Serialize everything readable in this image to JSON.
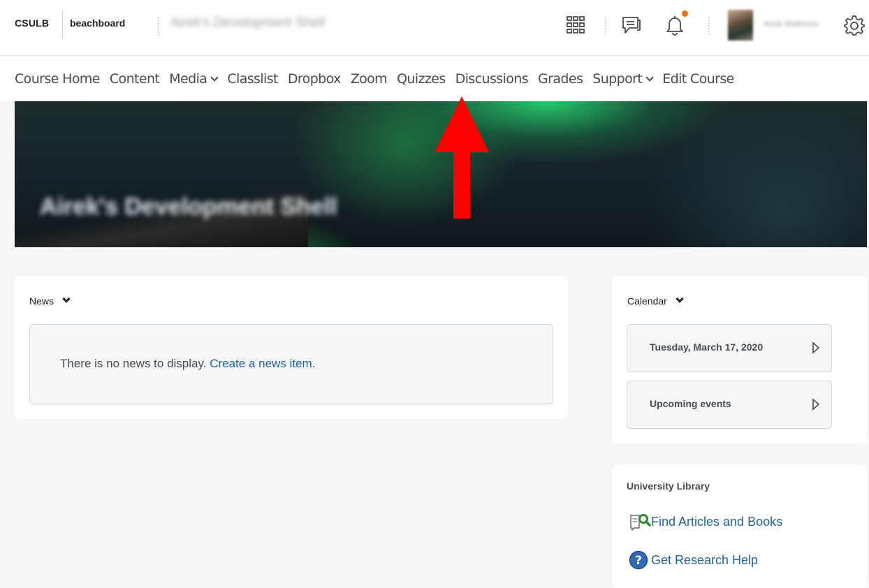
{
  "header": {
    "brand_left": "CSULB",
    "brand_right": "beachboard",
    "course_title": "Airek's Development Shell",
    "user_name": "Airek Mathews"
  },
  "nav": {
    "items": [
      {
        "label": "Course Home",
        "dropdown": false
      },
      {
        "label": "Content",
        "dropdown": false
      },
      {
        "label": "Media",
        "dropdown": true
      },
      {
        "label": "Classlist",
        "dropdown": false
      },
      {
        "label": "Dropbox",
        "dropdown": false
      },
      {
        "label": "Zoom",
        "dropdown": false
      },
      {
        "label": "Quizzes",
        "dropdown": false
      },
      {
        "label": "Discussions",
        "dropdown": false
      },
      {
        "label": "Grades",
        "dropdown": false
      },
      {
        "label": "Support",
        "dropdown": true
      },
      {
        "label": "Edit Course",
        "dropdown": false
      }
    ]
  },
  "banner": {
    "title": "Airek's Development Shell"
  },
  "news": {
    "heading": "News",
    "empty_text": "There is no news to display.",
    "create_link": "Create a news item."
  },
  "calendar": {
    "heading": "Calendar",
    "date": "Tuesday, March 17, 2020",
    "upcoming": "Upcoming events"
  },
  "library": {
    "heading": "University Library",
    "find_link": "Find Articles and Books",
    "help_link": "Get Research Help"
  },
  "colors": {
    "link": "#22649c",
    "annotation_arrow": "#ff0000",
    "notification_dot": "#e87511"
  },
  "icons": [
    "waffle-icon",
    "message-icon",
    "bell-icon",
    "gear-icon",
    "chevron-down-icon",
    "play-triangle-icon",
    "search-book-icon",
    "help-circle-icon"
  ]
}
